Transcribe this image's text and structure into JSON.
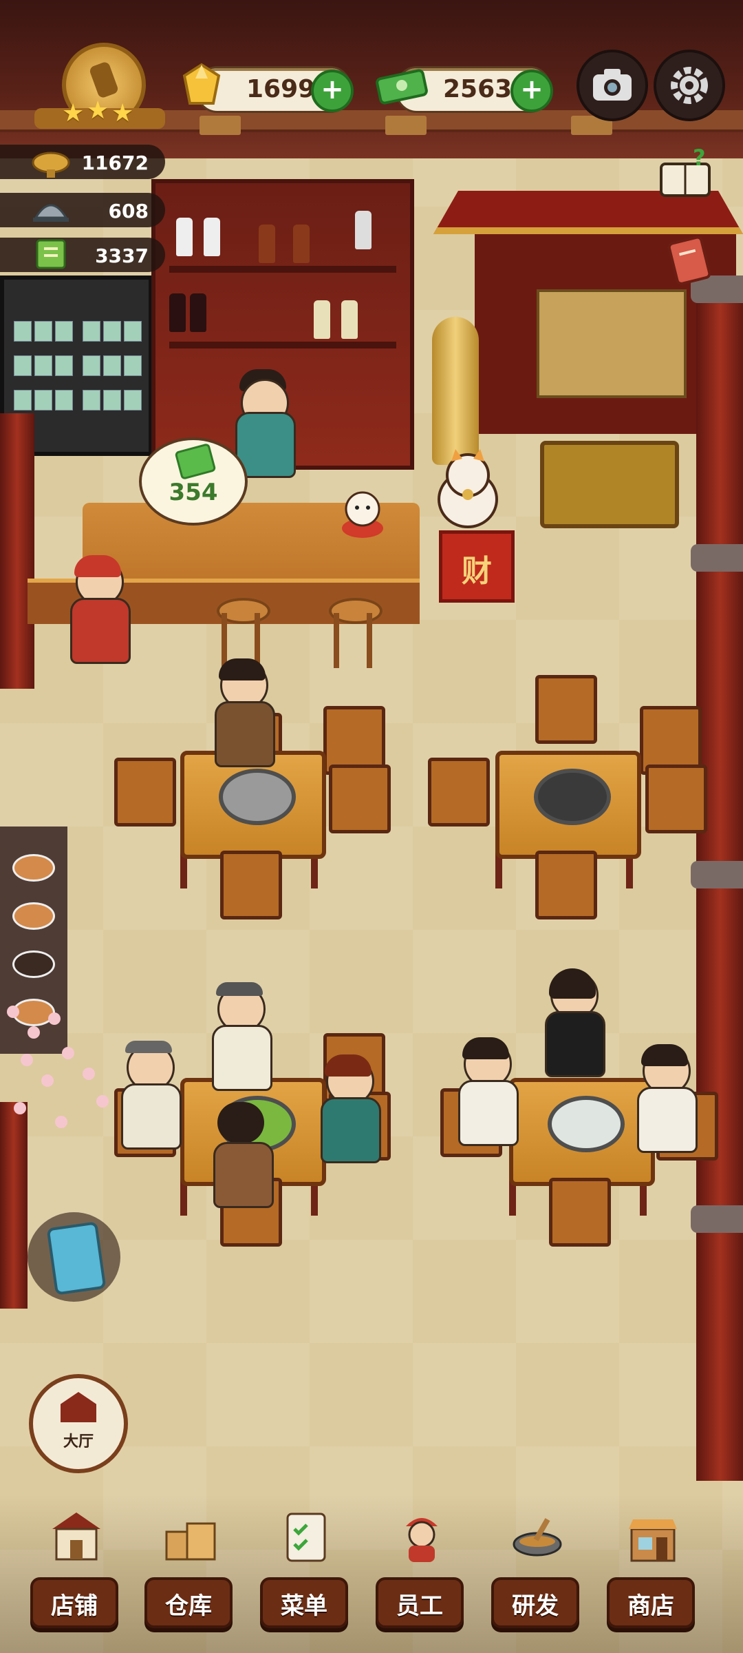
{
  "hud": {
    "gems": "1699",
    "cash": "25633",
    "stars": 3
  },
  "stats": {
    "trophies": "11672",
    "dishes": "608",
    "recipes": "3337"
  },
  "scene": {
    "money_bubble_amount": "354",
    "cai_char": "财"
  },
  "side": {
    "hall_label": "大厅"
  },
  "nav": [
    {
      "label": "店铺",
      "icon": "shop-building-icon"
    },
    {
      "label": "仓库",
      "icon": "warehouse-boxes-icon"
    },
    {
      "label": "菜单",
      "icon": "menu-clipboard-icon"
    },
    {
      "label": "员工",
      "icon": "staff-chef-icon"
    },
    {
      "label": "研发",
      "icon": "research-wok-icon"
    },
    {
      "label": "商店",
      "icon": "store-front-icon"
    }
  ],
  "colors": {
    "plus_green": "#3da23a",
    "wood_red": "#6b2d14",
    "gold": "#f2c66b"
  }
}
